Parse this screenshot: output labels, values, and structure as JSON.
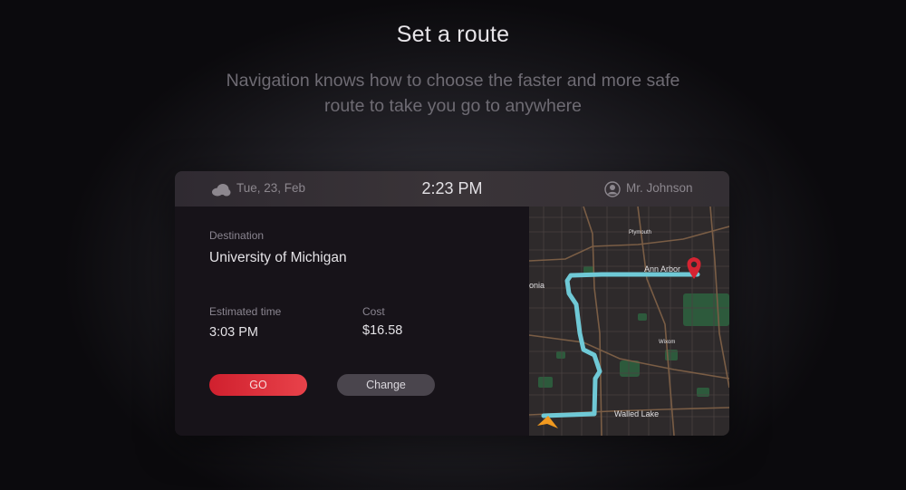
{
  "header": {
    "title": "Set a route",
    "subtitle": "Navigation knows how to choose the faster and more safe route to take  you go to anywhere"
  },
  "topbar": {
    "date": "Tue, 23, Feb",
    "weather_icon": "cloud-icon",
    "time": "2:23 PM",
    "user_icon": "user-avatar-icon",
    "user_name": "Mr. Johnson"
  },
  "trip": {
    "destination_label": "Destination",
    "destination_value": "University of Michigan",
    "eta_label": "Estimated time",
    "eta_value": "3:03 PM",
    "cost_label": "Cost",
    "cost_value": "$16.58"
  },
  "actions": {
    "go_label": "GO",
    "change_label": "Change"
  },
  "map": {
    "places": {
      "plymouth": "Plymouth",
      "ann_arbor": "Ann Arbor",
      "livonia": "onia",
      "wixom": "Wixom",
      "walled_lake": "Walled Lake"
    },
    "colors": {
      "route": "#6fc9d6",
      "pin": "#d42432",
      "arrow": "#f29a1f",
      "park": "#2d5a3c",
      "road": "#7a5d45"
    }
  },
  "colors": {
    "accent": "#e0303c",
    "background": "#0b0a0d",
    "panel": "#19161b"
  }
}
